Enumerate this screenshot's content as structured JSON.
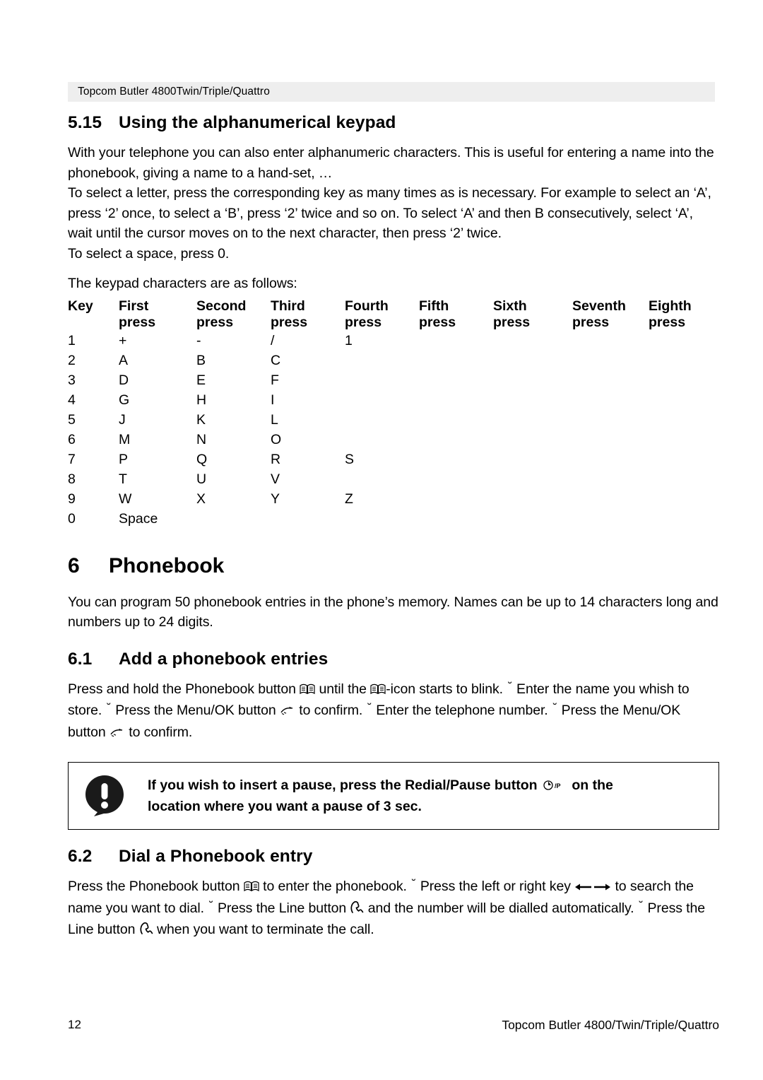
{
  "header": {
    "running_head": "Topcom Butler 4800Twin/Triple/Quattro"
  },
  "section_5_15": {
    "number": "5.15",
    "title": "Using the alphanumerical keypad",
    "para1": "With your telephone you can also enter alphanumeric characters. This is useful for entering a name into the phonebook, giving a name to a hand-set, …",
    "para2": "To select a letter, press the corresponding key as many times as is necessary. For example to select an ‘A’, press ‘2’ once, to select a ‘B’, press ‘2’ twice and so on. To select ‘A’ and then B consecutively, select ‘A’, wait until the cursor moves on to the next character, then press ‘2’ twice.",
    "para3": "To select a space, press 0.",
    "para4": "The keypad characters are as follows:"
  },
  "keypad_table": {
    "headers_line1": [
      "Key",
      "First",
      "Second",
      "Third",
      "Fourth",
      "Fifth",
      "Sixth",
      "Seventh",
      "Eighth"
    ],
    "headers_line2": [
      "",
      "press",
      "press",
      "press",
      "press",
      "press",
      "press",
      "press",
      "press"
    ],
    "rows": [
      [
        "1",
        "+",
        "-",
        "/",
        "1",
        "",
        "",
        "",
        ""
      ],
      [
        "2",
        "A",
        "B",
        "C",
        "",
        "",
        "",
        "",
        ""
      ],
      [
        "3",
        "D",
        "E",
        "F",
        "",
        "",
        "",
        "",
        ""
      ],
      [
        "4",
        "G",
        "H",
        "I",
        "",
        "",
        "",
        "",
        ""
      ],
      [
        "5",
        "J",
        "K",
        "L",
        "",
        "",
        "",
        "",
        ""
      ],
      [
        "6",
        "M",
        "N",
        "O",
        "",
        "",
        "",
        "",
        ""
      ],
      [
        "7",
        "P",
        "Q",
        "R",
        "S",
        "",
        "",
        "",
        ""
      ],
      [
        "8",
        "T",
        "U",
        "V",
        "",
        "",
        "",
        "",
        ""
      ],
      [
        "9",
        "W",
        "X",
        "Y",
        "Z",
        "",
        "",
        "",
        ""
      ],
      [
        "0",
        "Space",
        "",
        "",
        "",
        "",
        "",
        "",
        ""
      ]
    ]
  },
  "chapter_6": {
    "number": "6",
    "title": "Phonebook",
    "para1": "You can program 50 phonebook entries in the phone’s memory.  Names can be up to 14 characters long and numbers up to 24 digits."
  },
  "section_6_1": {
    "number": "6.1",
    "title": "Add a phonebook entries",
    "text_parts": {
      "p1": "Press and hold the Phonebook button ",
      "p2": " until the ",
      "p3": "-icon starts to blink. ",
      "p4": " Enter the name you whish to store. ",
      "p5": " Press the Menu/OK button ",
      "p6": " to confirm. ",
      "p7": " Enter the telephone number. ",
      "p8": " Press the Menu/OK button ",
      "p9": " to confirm."
    }
  },
  "notebox": {
    "line1_a": "If you wish to insert a pause, press the Redial/Pause button ",
    "line1_b": " on the",
    "line2": "location where you want a pause of 3 sec.",
    "icon_label": "!"
  },
  "section_6_2": {
    "number": "6.2",
    "title": "Dial a Phonebook entry",
    "text_parts": {
      "p1": "Press the Phonebook button ",
      "p2": " to enter the phonebook. ",
      "p3": " Press the left or right key ",
      "p4": " to search the name you want to dial. ",
      "p5": " Press the Line button ",
      "p6": " and the number will be dialled automatically. ",
      "p7": " Press the Line button ",
      "p8": " when you want to terminate the call."
    }
  },
  "footer": {
    "page_number": "12",
    "product": "Topcom Butler 4800/Twin/Triple/Quattro"
  },
  "icons": {
    "phonebook": "book-icon",
    "menu_ok": "menu-ok-icon",
    "redial_pause": "redial-pause-icon",
    "line": "line-key-icon",
    "left_arrow": "left-arrow-icon",
    "right_arrow": "right-arrow-icon",
    "caret": "˘"
  },
  "colors": {
    "header_band": "#eeeeee",
    "text": "#000000",
    "background": "#ffffff"
  }
}
